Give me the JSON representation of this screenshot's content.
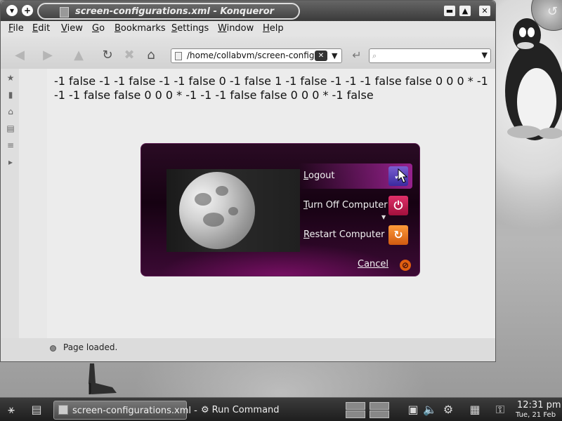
{
  "window": {
    "title": "screen-configurations.xml - Konqueror"
  },
  "menubar": {
    "items": [
      {
        "accel": "F",
        "rest": "ile"
      },
      {
        "accel": "E",
        "rest": "dit"
      },
      {
        "accel": "V",
        "rest": "iew"
      },
      {
        "accel": "G",
        "rest": "o"
      },
      {
        "accel": "B",
        "rest": "ookmarks"
      },
      {
        "accel": "S",
        "rest": "ettings"
      },
      {
        "accel": "W",
        "rest": "indow"
      },
      {
        "accel": "H",
        "rest": "elp"
      }
    ]
  },
  "toolbar": {
    "url_value": "/home/collabvm/screen-config",
    "search_value": ""
  },
  "content": {
    "text": "-1 false -1 -1 false -1 -1 false 0 -1 false 1 -1 false -1 -1 -1 false false 0 0 0 * -1 -1 -1 false false 0 0 0 * -1 -1 -1 false false 0 0 0 * -1 false"
  },
  "statusbar": {
    "text": "Page loaded."
  },
  "logout_dialog": {
    "buttons": [
      {
        "accel": "L",
        "rest": "ogout",
        "icon": "logout-icon"
      },
      {
        "accel": "T",
        "rest": "urn Off Computer",
        "icon": "power-icon"
      },
      {
        "accel": "R",
        "rest": "estart Computer",
        "icon": "restart-icon"
      }
    ],
    "cancel": {
      "accel": "C",
      "rest": "ancel"
    }
  },
  "taskbar": {
    "tasks": [
      {
        "label": "screen-configurations.xml -",
        "icon": "document-icon",
        "current": true
      },
      {
        "label": "Run Command",
        "icon": "gear-icon",
        "current": false
      }
    ],
    "clock": {
      "time": "12:31 pm",
      "date": "Tue, 21 Feb"
    }
  },
  "colors": {
    "dialog_bg": "#160212",
    "dialog_accent": "#b428aa",
    "taskbar_bg": "#2a2a2a"
  }
}
